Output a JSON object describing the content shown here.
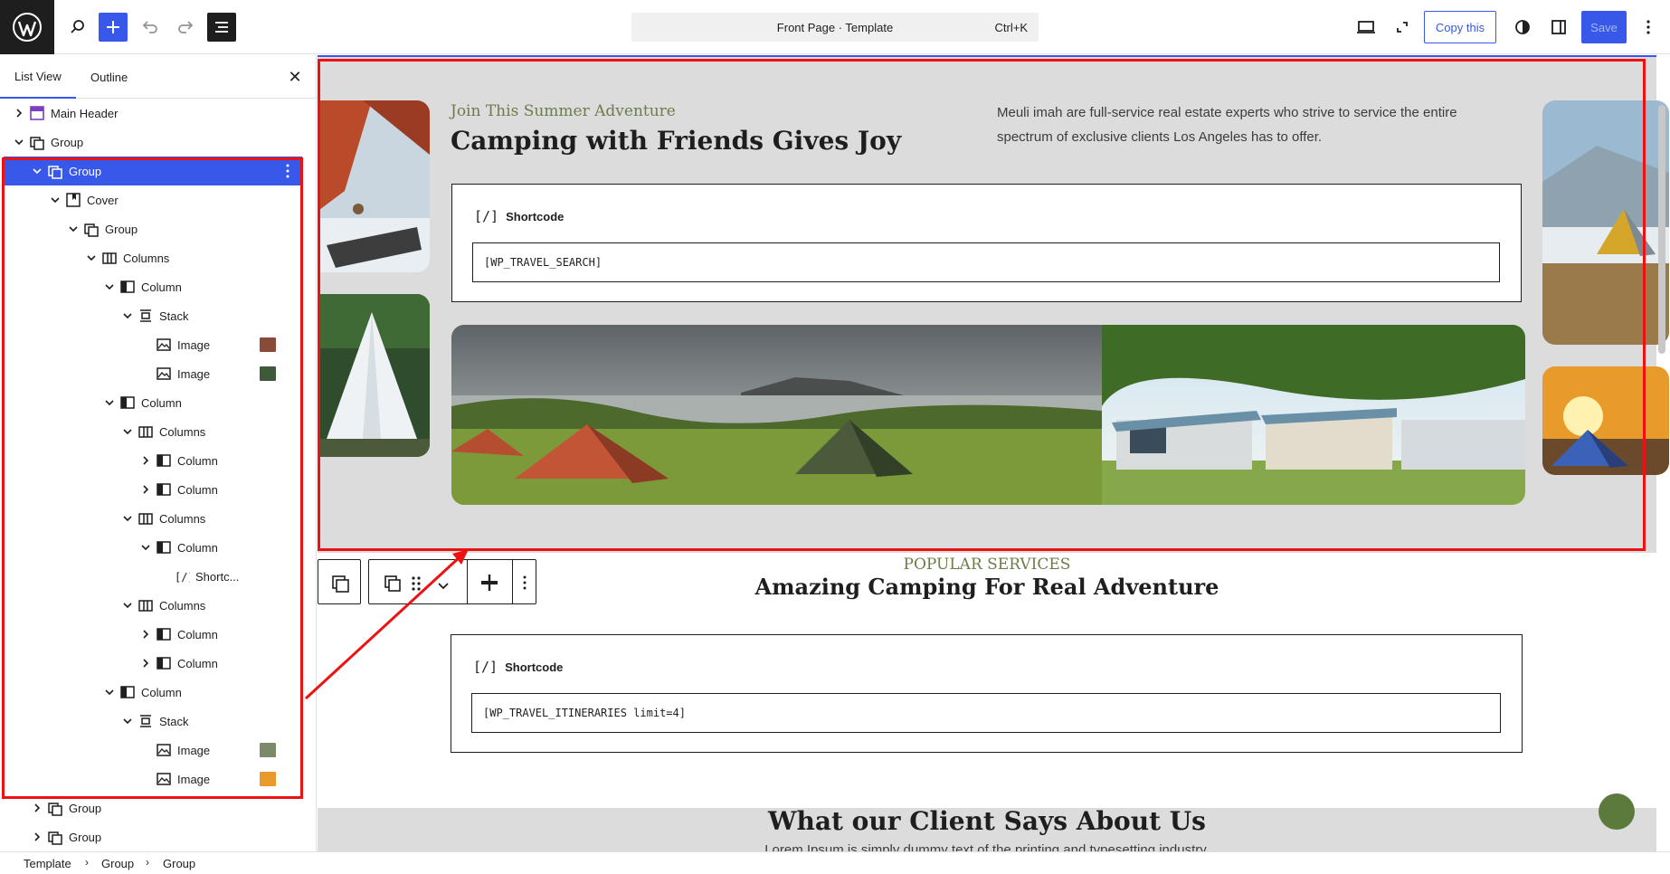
{
  "topbar": {
    "command_title": "Front Page · Template",
    "command_shortcut": "Ctrl+K",
    "copy_label": "Copy this",
    "save_label": "Save"
  },
  "sidebar": {
    "tab_list": "List View",
    "tab_outline": "Outline",
    "items": [
      {
        "label": "Main Header"
      },
      {
        "label": "Group"
      },
      {
        "label": "Group"
      },
      {
        "label": "Cover"
      },
      {
        "label": "Group"
      },
      {
        "label": "Columns"
      },
      {
        "label": "Column"
      },
      {
        "label": "Stack"
      },
      {
        "label": "Image"
      },
      {
        "label": "Image"
      },
      {
        "label": "Column"
      },
      {
        "label": "Columns"
      },
      {
        "label": "Column"
      },
      {
        "label": "Column"
      },
      {
        "label": "Columns"
      },
      {
        "label": "Column"
      },
      {
        "label": "Shortc..."
      },
      {
        "label": "Columns"
      },
      {
        "label": "Column"
      },
      {
        "label": "Column"
      },
      {
        "label": "Column"
      },
      {
        "label": "Stack"
      },
      {
        "label": "Image"
      },
      {
        "label": "Image"
      },
      {
        "label": "Group"
      },
      {
        "label": "Group"
      }
    ]
  },
  "breadcrumb": [
    "Template",
    "Group",
    "Group"
  ],
  "canvas": {
    "cover": {
      "kicker": "Join This Summer Adventure",
      "title": "Camping with Friends Gives Joy",
      "description": "Meuli imah are full-service real estate experts who strive to service the entire spectrum of exclusive clients Los Angeles has to offer.",
      "shortcode_label": "Shortcode",
      "shortcode_value": "[WP_TRAVEL_SEARCH]"
    },
    "services": {
      "kicker": "POPULAR SERVICES",
      "title": "Amazing Camping For Real Adventure",
      "shortcode_label": "Shortcode",
      "shortcode_value": "[WP_TRAVEL_ITINERARIES limit=4]"
    },
    "testimonials": {
      "title": "What our Client Says About Us",
      "subtitle": "Lorem Ipsum is simply dummy text of the printing and typesetting industry."
    }
  },
  "colors": {
    "accent": "#3858e9",
    "annotation": "#ee1111",
    "kicker": "#6b7d4a",
    "cover_bg": "#dcdcdc"
  }
}
